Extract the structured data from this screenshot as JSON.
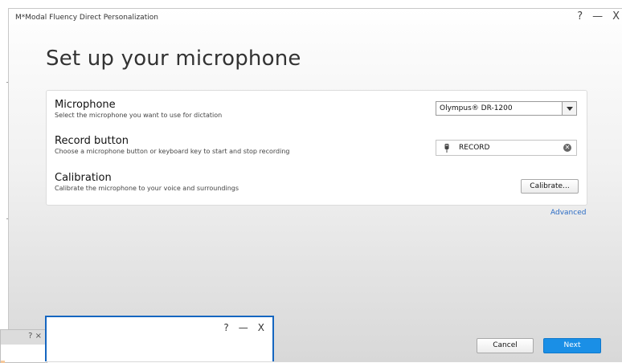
{
  "window": {
    "title": "M*Modal Fluency Direct Personalization",
    "controls": {
      "help": "?",
      "minimize": "—",
      "close": "X"
    }
  },
  "page": {
    "heading": "Set up your microphone"
  },
  "settings": {
    "microphone": {
      "title": "Microphone",
      "description": "Select the microphone you want to use for dictation",
      "selected": "Olympus® DR-1200"
    },
    "record_button": {
      "title": "Record button",
      "description": "Choose a microphone button or keyboard key to start and stop recording",
      "value": "RECORD"
    },
    "calibration": {
      "title": "Calibration",
      "description": "Calibrate the microphone to your voice and surroundings",
      "button_label": "Calibrate..."
    }
  },
  "links": {
    "advanced": "Advanced"
  },
  "footer": {
    "cancel_label": "Cancel",
    "next_label": "Next"
  },
  "overlay_windows": {
    "left_popup": {
      "controls": "? ×"
    },
    "center_popup": {
      "help": "?",
      "minimize": "—",
      "close": "X"
    }
  },
  "colors": {
    "accent": "#1a8fe6",
    "link": "#2a6bc4",
    "popup_border": "#1566c0"
  }
}
